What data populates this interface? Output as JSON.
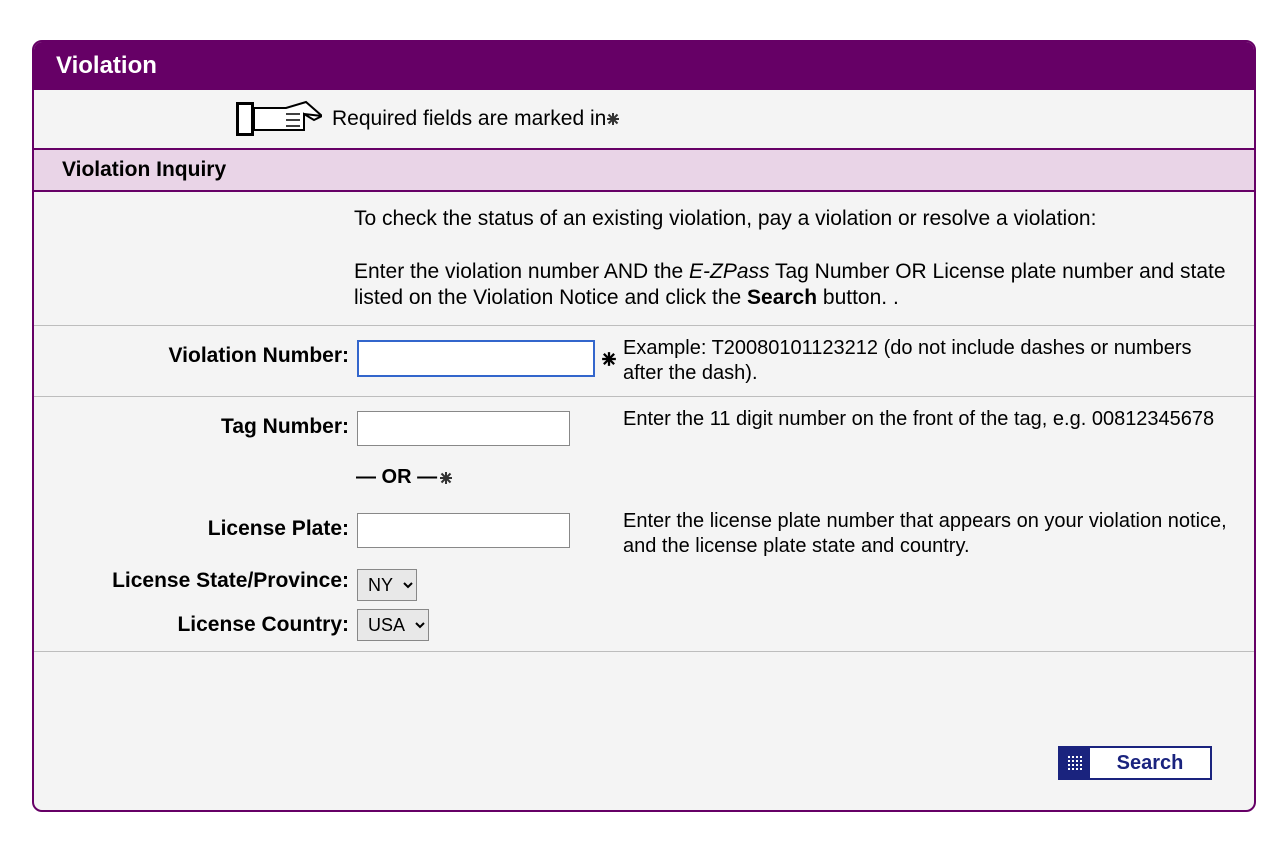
{
  "panel": {
    "title": "Violation",
    "required_text": "Required fields are marked in "
  },
  "section": {
    "title": "Violation Inquiry"
  },
  "intro": {
    "p1": "To check the status of an existing violation, pay a violation or resolve a violation:",
    "p2_prefix": "Enter the violation number AND the ",
    "p2_em": "E-ZPass",
    "p2_mid": " Tag Number OR License plate number and state listed on the Violation Notice and click the ",
    "p2_strong": "Search",
    "p2_suffix": " button. ."
  },
  "fields": {
    "violation_number": {
      "label": "Violation Number:",
      "value": "",
      "hint": "Example: T20080101123212 (do not include dashes or numbers after the dash)."
    },
    "tag_number": {
      "label": "Tag Number:",
      "value": "",
      "hint": "Enter the 11 digit number on the front of the tag, e.g. 00812345678"
    },
    "or_text": "— OR —",
    "license_plate": {
      "label": "License Plate:",
      "value": "",
      "hint": "Enter the license plate number that appears on your violation notice, and the license plate state and country."
    },
    "license_state": {
      "label": "License State/Province:",
      "value": "NY"
    },
    "license_country": {
      "label": "License Country:",
      "value": "USA"
    }
  },
  "buttons": {
    "search": "Search"
  }
}
